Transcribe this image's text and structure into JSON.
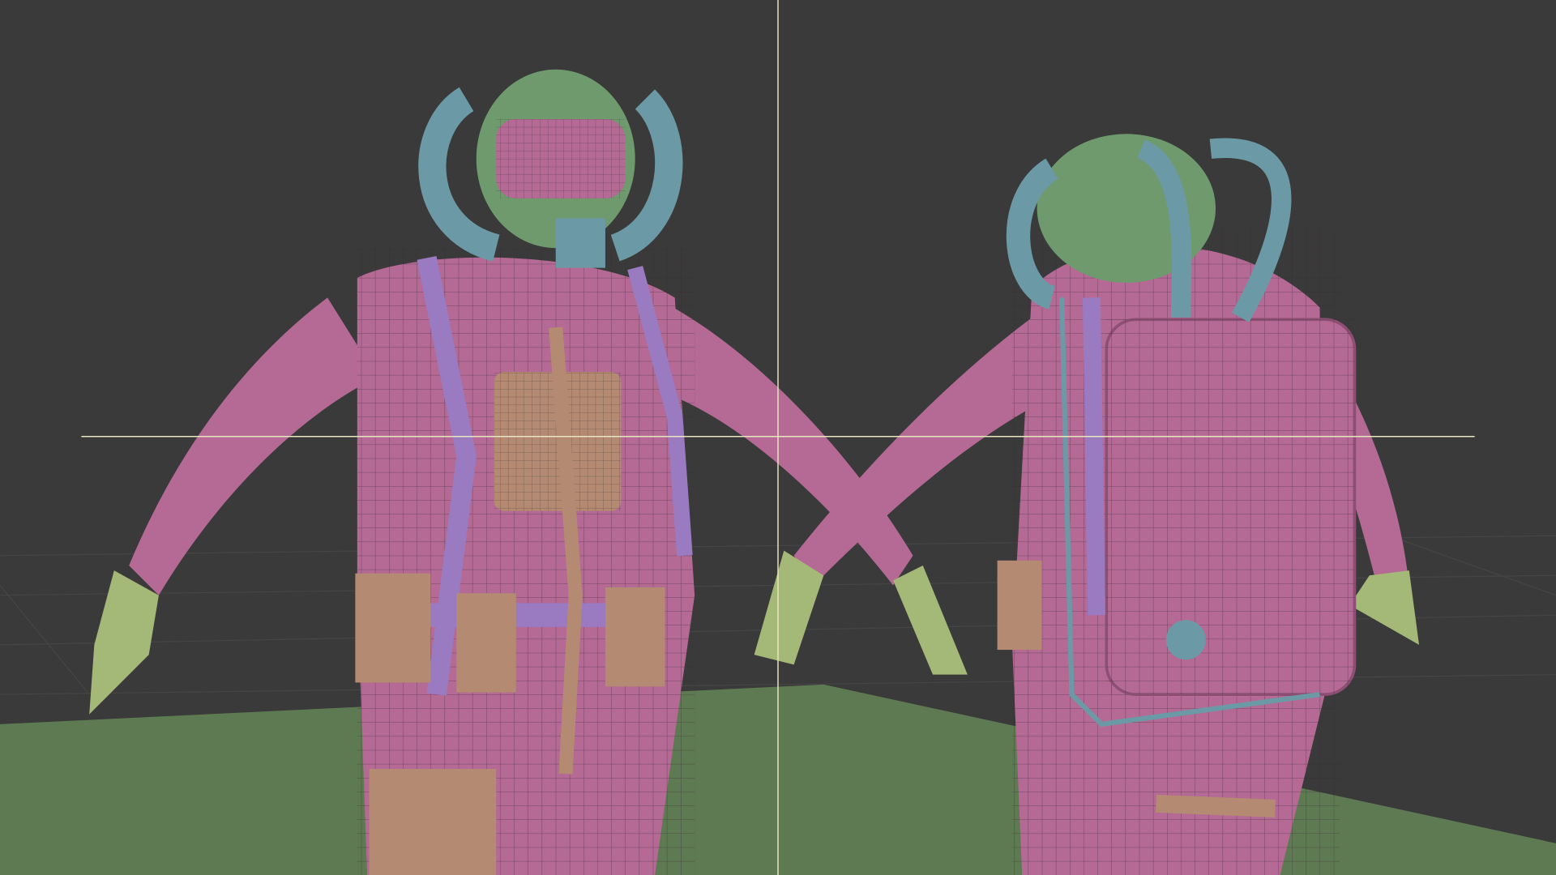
{
  "viewport": {
    "kind": "3d-viewport-wireframe-overlay",
    "colors": {
      "background": "#3a3a3a",
      "grid": "#454545",
      "ground": "#5e7a52",
      "suit": "#b46a94",
      "suit_shade": "#8e4f74",
      "helmet": "#6f9a6e",
      "hoses": "#6b9aa6",
      "straps": "#9a7ac0",
      "pouches": "#b58a72",
      "gloves": "#a4b878",
      "wire": "#3a2a34",
      "crosshair": "#e8e4c0"
    }
  }
}
